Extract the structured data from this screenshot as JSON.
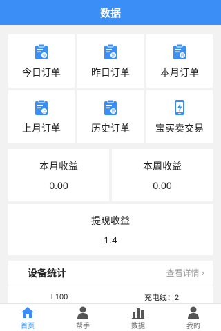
{
  "header": {
    "title": "数据"
  },
  "grid": {
    "tiles": [
      {
        "label": "今日订单",
        "icon": "clipboard-today-icon"
      },
      {
        "label": "昨日订单",
        "icon": "clipboard-yesterday-icon"
      },
      {
        "label": "本月订单",
        "icon": "clipboard-month-icon"
      },
      {
        "label": "上月订单",
        "icon": "clipboard-lastmonth-icon"
      },
      {
        "label": "历史订单",
        "icon": "clipboard-history-icon"
      },
      {
        "label": "宝买卖交易",
        "icon": "phone-charge-icon"
      }
    ]
  },
  "stats": {
    "month_label": "本月收益",
    "month_value": "0.00",
    "week_label": "本周收益",
    "week_value": "0.00"
  },
  "withdraw": {
    "label": "提现收益",
    "value": "1.4"
  },
  "device": {
    "title": "设备统计",
    "more": "查看详情",
    "cell_left": "L100",
    "cell_right": "充电线：2"
  },
  "tabbar": {
    "items": [
      {
        "label": "首页",
        "icon": "home-icon",
        "active": true
      },
      {
        "label": "帮手",
        "icon": "person-icon",
        "active": false
      },
      {
        "label": "数据",
        "icon": "bar-chart-icon",
        "active": false
      },
      {
        "label": "我的",
        "icon": "user-icon",
        "active": false
      }
    ]
  },
  "colors": {
    "accent": "#3a8ef6",
    "background": "#f2f2f2"
  }
}
